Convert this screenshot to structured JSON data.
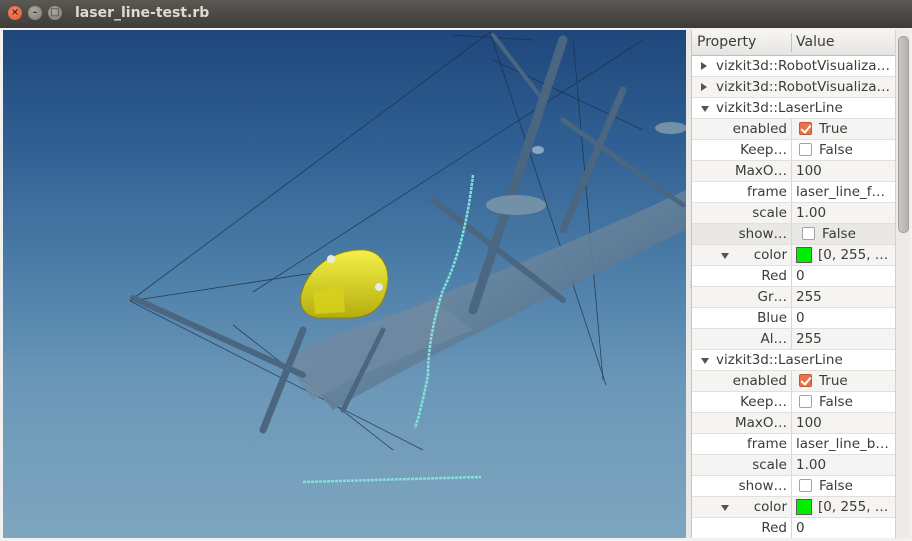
{
  "window": {
    "title": "laser_line-test.rb",
    "close_glyph": "×",
    "min_glyph": "–",
    "max_glyph": "□"
  },
  "panel": {
    "headers": {
      "property": "Property",
      "value": "Value"
    },
    "rows": [
      {
        "indent": 0,
        "expander": "right",
        "name": "vizkit3d::RobotVisualiza…",
        "value": ""
      },
      {
        "indent": 0,
        "expander": "right",
        "name": "vizkit3d::RobotVisualiza…",
        "value": ""
      },
      {
        "indent": 0,
        "expander": "down",
        "name": "vizkit3d::LaserLine",
        "value": ""
      },
      {
        "indent": 1,
        "name": "enabled",
        "checkbox": true,
        "value": "True"
      },
      {
        "indent": 1,
        "name": "Keep…",
        "checkbox": false,
        "value": "False"
      },
      {
        "indent": 1,
        "name": "MaxO…",
        "value": "100"
      },
      {
        "indent": 1,
        "name": "frame",
        "value": "laser_line_f…"
      },
      {
        "indent": 1,
        "name": "scale",
        "value": "1.00"
      },
      {
        "indent": 1,
        "name": "show…",
        "checkbox": false,
        "value": "False",
        "highlight": true
      },
      {
        "indent": 1,
        "expander": "down",
        "name": "color",
        "swatch": "#00ee00",
        "value": "[0, 255, …"
      },
      {
        "indent": 2,
        "name": "Red",
        "value": "0"
      },
      {
        "indent": 2,
        "name": "Gr…",
        "value": "255"
      },
      {
        "indent": 2,
        "name": "Blue",
        "value": "0"
      },
      {
        "indent": 2,
        "name": "Al…",
        "value": "255"
      },
      {
        "indent": 0,
        "expander": "down",
        "name": "vizkit3d::LaserLine",
        "value": ""
      },
      {
        "indent": 1,
        "name": "enabled",
        "checkbox": true,
        "value": "True"
      },
      {
        "indent": 1,
        "name": "Keep…",
        "checkbox": false,
        "value": "False"
      },
      {
        "indent": 1,
        "name": "MaxO…",
        "value": "100"
      },
      {
        "indent": 1,
        "name": "frame",
        "value": "laser_line_b…"
      },
      {
        "indent": 1,
        "name": "scale",
        "value": "1.00"
      },
      {
        "indent": 1,
        "name": "show…",
        "checkbox": false,
        "value": "False"
      },
      {
        "indent": 1,
        "expander": "down",
        "name": "color",
        "swatch": "#00ee00",
        "value": "[0, 255, …"
      },
      {
        "indent": 2,
        "name": "Red",
        "value": "0"
      }
    ]
  },
  "colors": {
    "water_top": "#1f477c",
    "water_bottom": "#7fa6c0",
    "robot": "#e7e21c",
    "laser": "#7fe3d6",
    "checkbox_on": "#e7734a"
  },
  "icons": {
    "close": "close-icon",
    "minimize": "minimize-icon",
    "maximize": "maximize-icon",
    "expand": "triangle-right-icon",
    "collapse": "triangle-down-icon"
  }
}
